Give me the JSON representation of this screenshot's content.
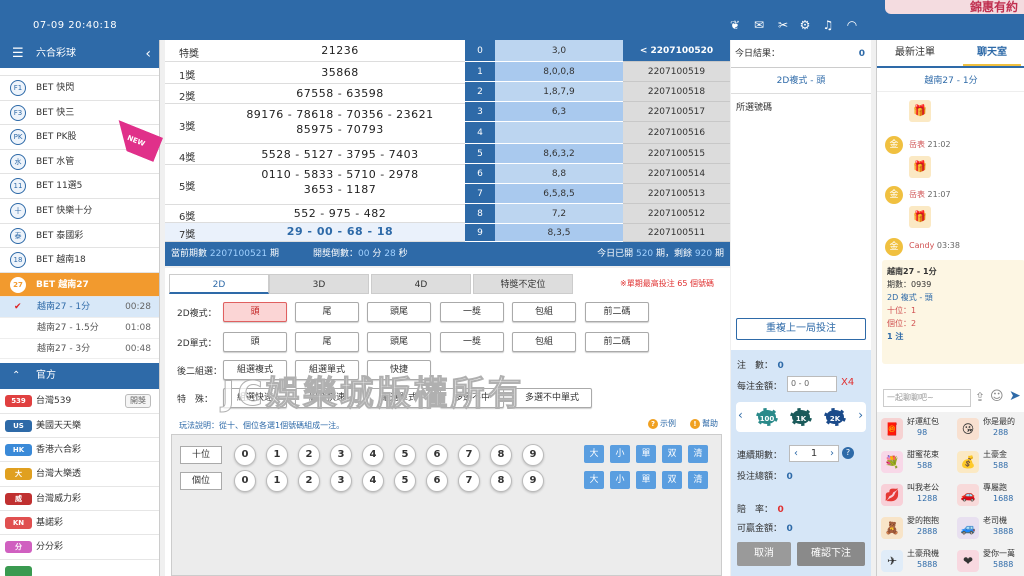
{
  "topbar": {
    "time": "07-09 20:40:18",
    "banner_text": "錦惠有約"
  },
  "sidebar": {
    "title": "六合彩球",
    "items": [
      {
        "label": "BET 快閃",
        "icon": "F1"
      },
      {
        "label": "BET 快三",
        "icon": "F3"
      },
      {
        "label": "BET PK股",
        "icon": "PK"
      },
      {
        "label": "BET 水管",
        "icon": "水"
      },
      {
        "label": "BET 11選5",
        "icon": "11"
      },
      {
        "label": "BET 快樂十分",
        "icon": "十"
      },
      {
        "label": "BET 泰國彩",
        "icon": "泰"
      },
      {
        "label": "BET 越南18",
        "icon": "18"
      },
      {
        "label": "BET 越南27",
        "icon": "27"
      }
    ],
    "new_badge": "NEW",
    "subs": [
      {
        "label": "越南27 - 1分",
        "time": "00:28"
      },
      {
        "label": "越南27 - 1.5分",
        "time": "01:08"
      },
      {
        "label": "越南27 - 3分",
        "time": "00:48"
      }
    ],
    "official_title": "官方",
    "official": [
      {
        "label": "台灣539",
        "logo": "539",
        "tag": "開獎"
      },
      {
        "label": "美國天天樂",
        "logo": "US"
      },
      {
        "label": "香港六合彩",
        "logo": "HK"
      },
      {
        "label": "台灣大樂透",
        "logo": "大"
      },
      {
        "label": "台灣威力彩",
        "logo": "威"
      },
      {
        "label": "基諾彩",
        "logo": "KN"
      },
      {
        "label": "分分彩",
        "logo": "分"
      },
      {
        "label": "",
        "logo": ""
      }
    ]
  },
  "results": [
    {
      "label": "特獎",
      "value": "21236"
    },
    {
      "label": "1獎",
      "value": "35868"
    },
    {
      "label": "2獎",
      "value": "67558 - 63598"
    },
    {
      "label": "3獎",
      "value": "89176 - 78618 - 70356 - 23621",
      "value2": "85975 - 70793"
    },
    {
      "label": "4獎",
      "value": "5528 - 5127 - 3795 - 7403"
    },
    {
      "label": "5獎",
      "value": "0110 - 5833 - 5710 - 2978",
      "value2": "3653 - 1187"
    },
    {
      "label": "6獎",
      "value": "552 - 975 - 482"
    },
    {
      "label": "7獎",
      "value": "29 - 00 - 68 - 18"
    }
  ],
  "index_col": [
    "0",
    "1",
    "2",
    "3",
    "4",
    "5",
    "6",
    "7",
    "8",
    "9"
  ],
  "nums_col": [
    "3,0",
    "8,0,0,8",
    "1,8,7,9",
    "6,3",
    "",
    "8,6,3,2",
    "8,8",
    "6,5,8,5",
    "7,2",
    "8,3,5"
  ],
  "periods": [
    "< 2207100520",
    "2207100519",
    "2207100518",
    "2207100517",
    "2207100516",
    "2207100515",
    "2207100514",
    "2207100513",
    "2207100512",
    "2207100511"
  ],
  "infobar": {
    "cur_label": "當前期數",
    "cur_value": "2207100521",
    "cur_unit": "期",
    "cd_label": "開獎倒數：",
    "cd_min": "00",
    "cd_min_unit": "分",
    "cd_sec": "28",
    "cd_sec_unit": "秒",
    "today_prefix": "今日已開",
    "opened": "520",
    "opened_unit": "期，剩餘",
    "remaining": "920",
    "remaining_unit": "期"
  },
  "bet": {
    "tabs": [
      "2D",
      "3D",
      "4D",
      "特獎不定位"
    ],
    "max_note": "※單期最高投注 65 個號碼",
    "row1_label": "2D複式：",
    "row2_label": "2D單式：",
    "row3_label": "後二組選：",
    "row4_label": "特　殊：",
    "row1_opts": [
      "頭",
      "尾",
      "頭尾",
      "一獎",
      "包組",
      "前二碼"
    ],
    "row2_opts": [
      "頭",
      "尾",
      "頭尾",
      "一獎",
      "包組",
      "前二碼"
    ],
    "row3_opts": [
      "組選複式",
      "組選單式",
      "快捷"
    ],
    "row4_opts": [
      "組選快速",
      "組合快速",
      "組選單式",
      "多選不中",
      "多選不中單式"
    ],
    "help_text": "玩法說明：從十、個位各選1個號碼組成一注。",
    "example": "示例",
    "help": "幫助",
    "positions": [
      "十位",
      "個位"
    ],
    "digits": [
      "0",
      "1",
      "2",
      "3",
      "4",
      "5",
      "6",
      "7",
      "8",
      "9"
    ],
    "quick": [
      "大",
      "小",
      "單",
      "双",
      "清"
    ],
    "watermark": "JC娛樂城版權所有"
  },
  "order": {
    "today_label": "今日結果：",
    "today_value": "0",
    "mode": "2D複式 - 頭",
    "selected_label": "所選號碼",
    "repeat": "重複上一局投注",
    "count_label": "注　數：",
    "count_value": "0",
    "amount_label": "每注金額：",
    "amount_placeholder": "0 - 0",
    "multiplier": "X4",
    "chips": [
      "100",
      "1K",
      "2K"
    ],
    "periods_label": "連續期數：",
    "periods_value": "1",
    "total_label": "投注總額：",
    "total_value": "0",
    "odds_label": "賠　率：",
    "odds_value": "0",
    "win_label": "可贏金額：",
    "win_value": "0",
    "cancel": "取消",
    "confirm": "確認下注"
  },
  "chat": {
    "tab_latest": "最新注單",
    "tab_chat": "聊天室",
    "room": "越南27 - 1分",
    "msgs": [
      {
        "avatar": "金",
        "name": "",
        "time": "",
        "gift": "🎁"
      },
      {
        "avatar": "金",
        "name": "岳表",
        "time": "21:02",
        "gift": "🎁"
      },
      {
        "avatar": "金",
        "name": "岳表",
        "time": "21:07",
        "gift": "🎁"
      },
      {
        "avatar": "金",
        "name": "Candy",
        "time": "03:38",
        "gift": ""
      }
    ],
    "card": {
      "title": "越南27 - 1分",
      "period": "期數：0939",
      "type": "2D 複式 - 頭",
      "a": "十位：1",
      "b": "個位：2",
      "notes": "1 注"
    },
    "input_placeholder": "一起聊聊吧~",
    "gifts": [
      {
        "name": "好運紅包",
        "price": "98",
        "icon": "🧧"
      },
      {
        "name": "你是最的",
        "price": "288",
        "icon": "😘"
      },
      {
        "name": "甜蜜花束",
        "price": "588",
        "icon": "💐"
      },
      {
        "name": "土豪金",
        "price": "588",
        "icon": "💰"
      },
      {
        "name": "叫我老公",
        "price": "1288",
        "icon": "💋"
      },
      {
        "name": "專屬跑",
        "price": "1688",
        "icon": "🚗"
      },
      {
        "name": "愛的抱抱",
        "price": "2888",
        "icon": "🧸"
      },
      {
        "name": "老司機",
        "price": "3888",
        "icon": "🚙"
      },
      {
        "name": "土豪飛機",
        "price": "5888",
        "icon": "✈"
      },
      {
        "name": "愛你一萬",
        "price": "5888",
        "icon": "❤"
      }
    ]
  }
}
